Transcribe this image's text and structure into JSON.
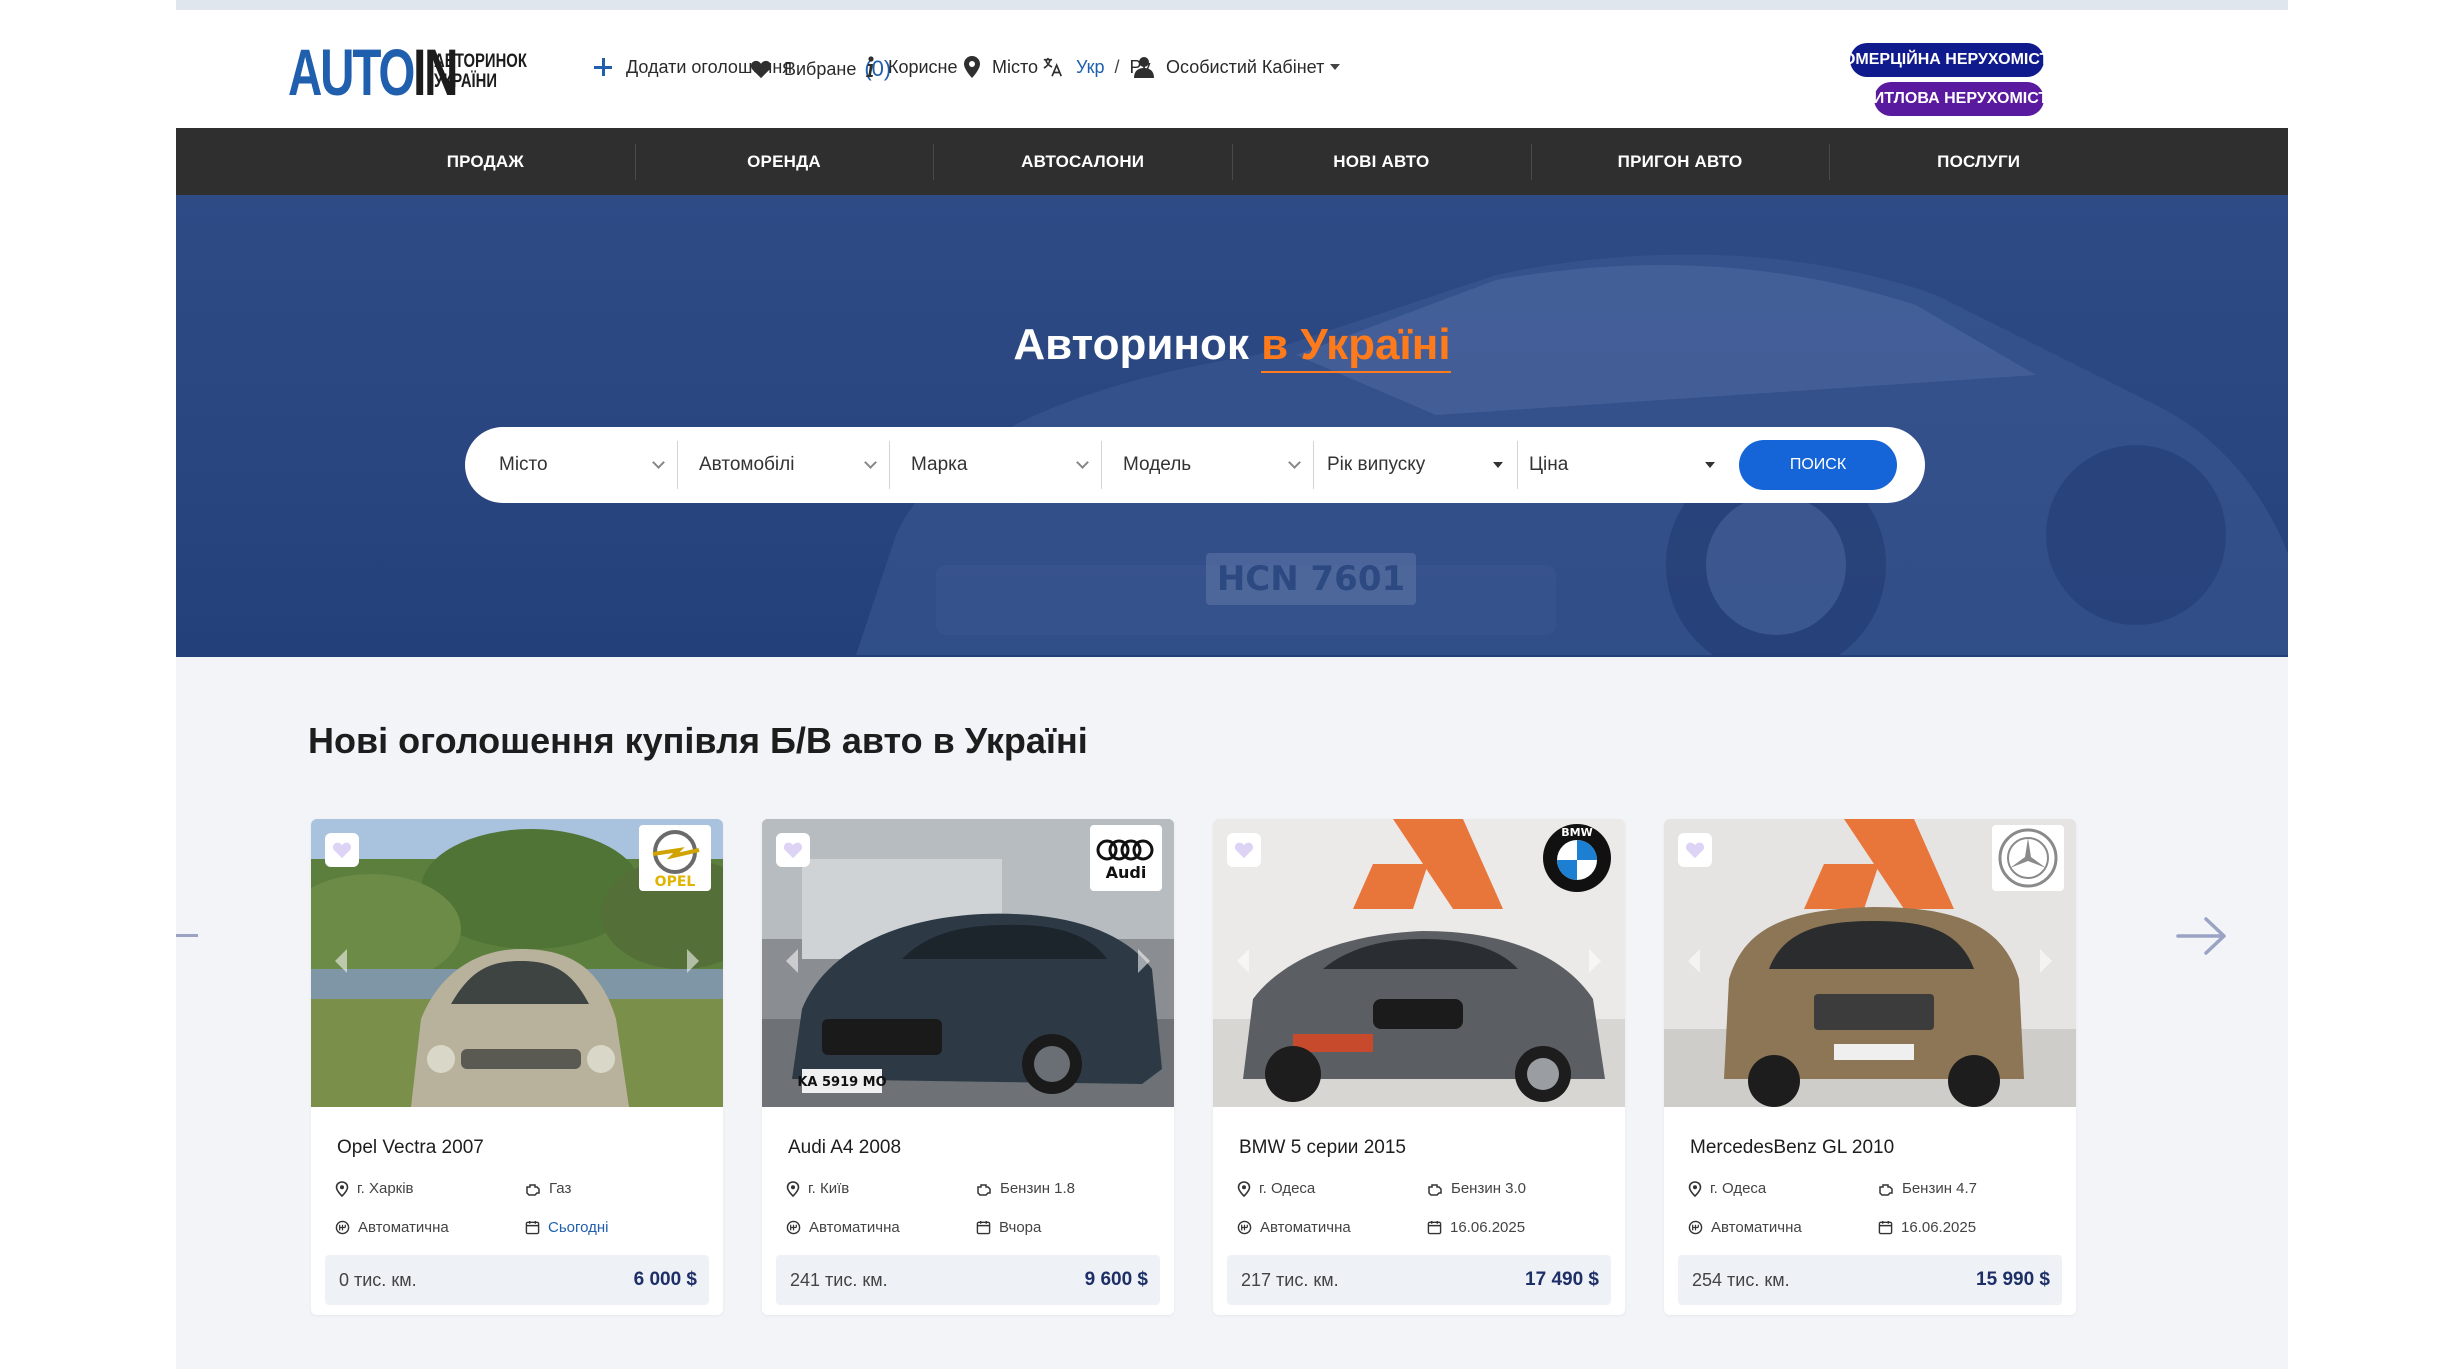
{
  "header": {
    "logo_auto": "AUTO",
    "logo_in": "IN",
    "logo_sub_1": "АВТОРИНОК",
    "logo_sub_2": "УКРАЇНИ",
    "add_listing": "Додати оголошення",
    "favorites": "Вибране",
    "favorites_count": "(0)",
    "useful": "Корисне",
    "city": "Місто",
    "lang_ukr": "Укр",
    "lang_sep": "/",
    "lang_ru": "Ру",
    "cabinet": "Особистий Кабінет",
    "commercial": "КОМЕРЦІЙНА НЕРУХОМІСТЬ",
    "living": "ЖИТЛОВА НЕРУХОМІСТЬ"
  },
  "nav": {
    "items": [
      "ПРОДАЖ",
      "ОРЕНДА",
      "АВТОСАЛОНИ",
      "НОВІ АВТО",
      "ПРИГОН АВТО",
      "ПОСЛУГИ"
    ]
  },
  "hero": {
    "title_main": "Авторинок ",
    "title_accent": "в Україні",
    "plate": "HCN 7601"
  },
  "search": {
    "city": "Місто",
    "vehicle": "Автомобілі",
    "brand": "Марка",
    "model": "Модель",
    "year": "Рік випуску",
    "price": "Ціна",
    "button": "ПОИСК"
  },
  "listings": {
    "title": "Нові оголошення купівля Б/В авто в Україні",
    "cards": [
      {
        "title": "Opel Vectra 2007",
        "city": "г. Харків",
        "fuel": "Газ",
        "gearbox": "Автоматична",
        "date": "Сьогодні",
        "mileage": "0 тис. км.",
        "price": "6 000 $",
        "brand": "OPEL",
        "plate": ""
      },
      {
        "title": "Audi A4 2008",
        "city": "г. Київ",
        "fuel": "Бензин 1.8",
        "gearbox": "Автоматична",
        "date": "Вчора",
        "mileage": "241 тис. км.",
        "price": "9 600 $",
        "brand": "Audi",
        "plate": "KA 5919 MO"
      },
      {
        "title": "BMW 5 серии 2015",
        "city": "г. Одеса",
        "fuel": "Бензин 3.0",
        "gearbox": "Автоматична",
        "date": "16.06.2025",
        "mileage": "217 тис. км.",
        "price": "17 490 $",
        "brand": "BMW",
        "plate": ""
      },
      {
        "title": "MercedesBenz GL 2010",
        "city": "г. Одеса",
        "fuel": "Бензин 4.7",
        "gearbox": "Автоматична",
        "date": "16.06.2025",
        "mileage": "254 тис. км.",
        "price": "15 990 $",
        "brand": "",
        "plate": ""
      }
    ]
  },
  "colors": {
    "brand_blue": "#1f5fad",
    "nav_bg": "#2f2f2f",
    "hero_bg": "#2e4b86",
    "accent_orange": "#ff7a1a",
    "button_blue": "#1565d8",
    "price_navy": "#1d2f66"
  },
  "icons": [
    "plus-icon",
    "heart-icon",
    "info-icon",
    "location-pin-icon",
    "translate-icon",
    "user-icon",
    "chevron-down-icon",
    "arrow-right-icon",
    "gearbox-icon",
    "engine-icon",
    "calendar-icon"
  ]
}
